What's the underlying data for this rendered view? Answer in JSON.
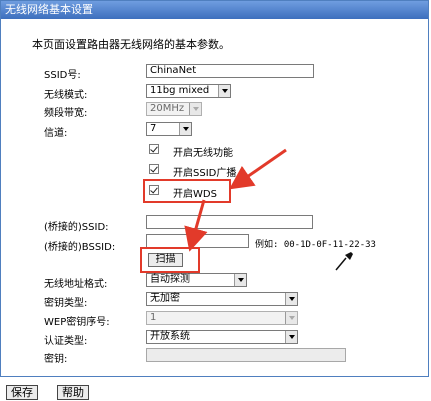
{
  "window": {
    "title": "无线网络基本设置"
  },
  "description": "本页面设置路由器无线网络的基本参数。",
  "form": {
    "ssid": {
      "label": "SSID号:",
      "value": "ChinaNet"
    },
    "mode": {
      "label": "无线模式:",
      "value": "11bg mixed"
    },
    "bandwidth": {
      "label": "频段带宽:",
      "value": "20MHz"
    },
    "channel": {
      "label": "信道:",
      "value": "7"
    },
    "enable_wireless": {
      "label": "开启无线功能"
    },
    "enable_ssid_broadcast": {
      "label": "开启SSID广播"
    },
    "enable_wds": {
      "label": "开启WDS"
    },
    "bridge_ssid": {
      "label": "(桥接的)SSID:",
      "value": ""
    },
    "bridge_bssid": {
      "label": "(桥接的)BSSID:",
      "value": "",
      "example": "例如: 00-1D-0F-11-22-33"
    },
    "scan_label": "扫描",
    "mac_format": {
      "label": "无线地址格式:",
      "value": "自动探测"
    },
    "key_type": {
      "label": "密钥类型:",
      "value": "无加密"
    },
    "wep_index": {
      "label": "WEP密钥序号:",
      "value": "1"
    },
    "auth_type": {
      "label": "认证类型:",
      "value": "开放系统"
    },
    "key": {
      "label": "密钥:",
      "value": ""
    }
  },
  "footer": {
    "save_label": "保存",
    "help_label": "帮助"
  },
  "colors": {
    "accent": "#3d6fbd",
    "annotation": "#e23a2a"
  }
}
